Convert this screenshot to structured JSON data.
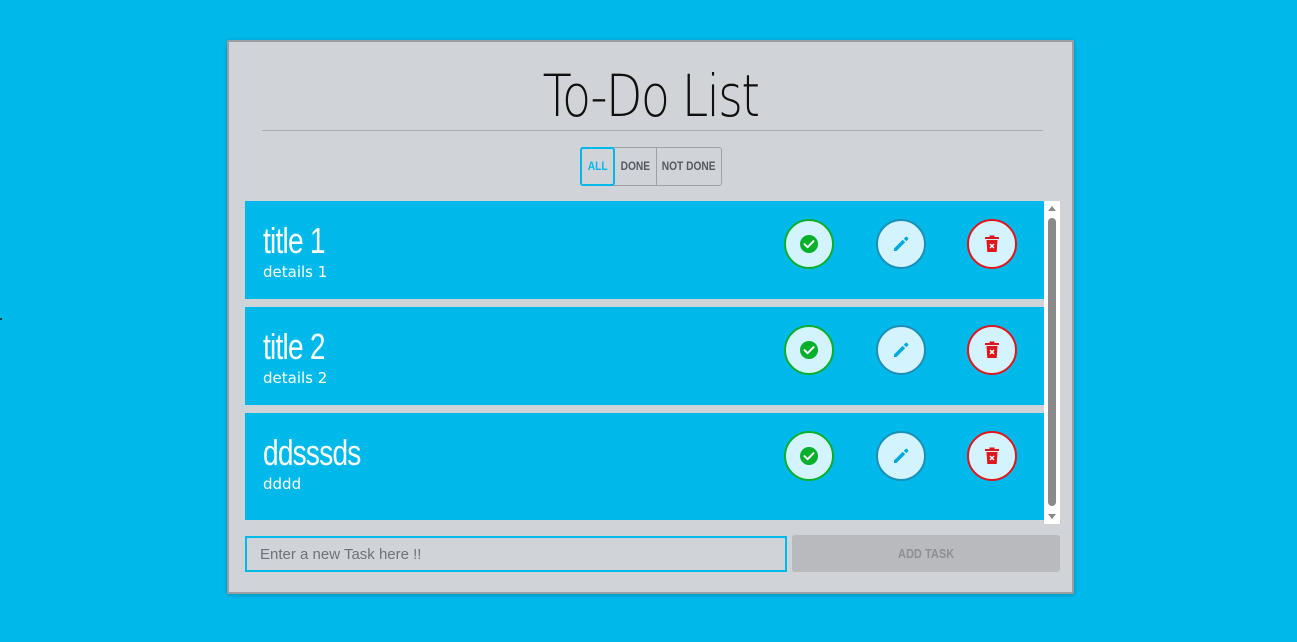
{
  "app": {
    "title": "To-Do List"
  },
  "filters": {
    "all": "ALL",
    "done": "DONE",
    "not_done": "NOT DONE",
    "active": "all"
  },
  "tasks": [
    {
      "title": "title 1",
      "details": "details 1"
    },
    {
      "title": "title 2",
      "details": "details 2"
    },
    {
      "title": "ddsssds",
      "details": "dddd"
    }
  ],
  "new_task": {
    "placeholder": "Enter a new Task here !!",
    "value": ""
  },
  "add_button": {
    "label": "ADD TASK"
  },
  "colors": {
    "background": "#00b9eb",
    "card": "#d0d4d8",
    "task": "#00b9eb",
    "check": "#06b02a",
    "edit": "#1b8fb6",
    "delete": "#e0161c"
  },
  "icons": {
    "check": "check-circle-icon",
    "edit": "pencil-icon",
    "delete": "trash-icon"
  }
}
